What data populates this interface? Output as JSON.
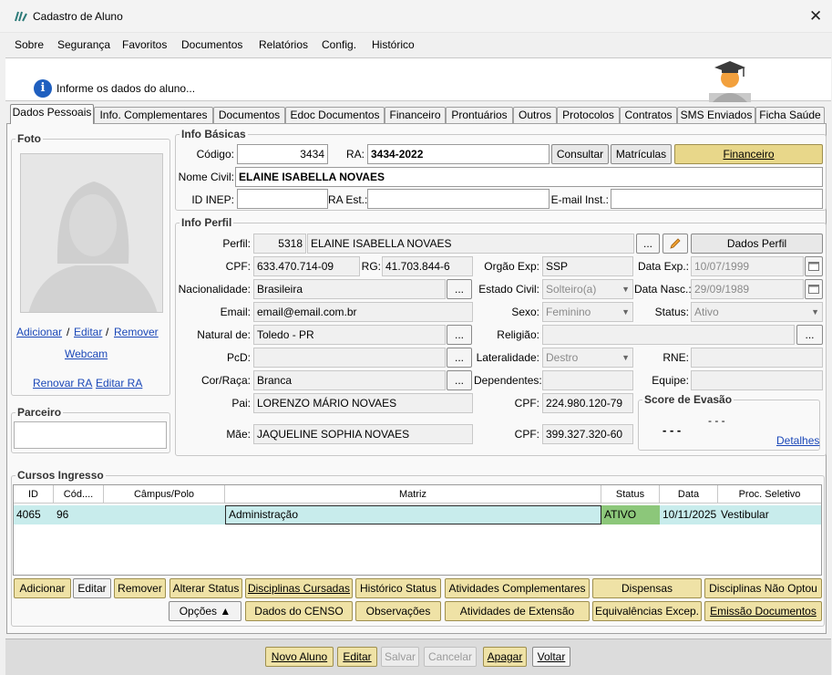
{
  "window": {
    "title": "Cadastro de Aluno",
    "close": "✕"
  },
  "menu": [
    "Sobre",
    "Segurança",
    "Favoritos",
    "Documentos",
    "Relatórios",
    "Config.",
    "Histórico"
  ],
  "header": {
    "text": "Informe os dados do aluno...",
    "info_icon": "i"
  },
  "tabs": [
    "Dados Pessoais",
    "Info. Complementares",
    "Documentos",
    "Edoc Documentos",
    "Financeiro",
    "Prontuários",
    "Outros",
    "Protocolos",
    "Contratos",
    "SMS Enviados",
    "Ficha Saúde"
  ],
  "foto": {
    "title": "Foto",
    "adicionar": "Adicionar",
    "sep1": "/",
    "editar": "Editar",
    "sep2": "/",
    "remover": "Remover",
    "webcam": "Webcam",
    "renovar_ra": "Renovar RA",
    "editar_ra": "Editar RA"
  },
  "parceiro": {
    "title": "Parceiro",
    "value": ""
  },
  "basicas": {
    "title": "Info Básicas",
    "codigo_label": "Código:",
    "codigo": "3434",
    "ra_label": "RA:",
    "ra": "3434-2022",
    "consultar": "Consultar",
    "matriculas": "Matrículas",
    "financeiro": "Financeiro",
    "nome_label": "Nome Civil:",
    "nome": "ELAINE ISABELLA NOVAES",
    "inep_label": "ID INEP:",
    "inep": "",
    "raest_label": "RA Est.:",
    "raest": "",
    "email_inst_label": "E-mail Inst.:",
    "email_inst": ""
  },
  "perfil": {
    "title": "Info Perfil",
    "perfil_label": "Perfil:",
    "perfil_id": "5318",
    "perfil_nome": "ELAINE ISABELLA NOVAES",
    "dots": "...",
    "dados_perfil": "Dados Perfil",
    "cpf_label": "CPF:",
    "cpf": "633.470.714-09",
    "rg_label": "RG:",
    "rg": "41.703.844-6",
    "orgao_label": "Orgão Exp:",
    "orgao": "SSP",
    "dataexp_label": "Data Exp.:",
    "dataexp": "10/07/1999",
    "nac_label": "Nacionalidade:",
    "nac": "Brasileira",
    "estcivil_label": "Estado Civil:",
    "estcivil": "Solteiro(a)",
    "datanasc_label": "Data Nasc.:",
    "datanasc": "29/09/1989",
    "email_label": "Email:",
    "email": "email@email.com.br",
    "sexo_label": "Sexo:",
    "sexo": "Feminino",
    "status_label": "Status:",
    "status": "Ativo",
    "natural_label": "Natural de:",
    "natural": "Toledo - PR",
    "religiao_label": "Religião:",
    "religiao": "",
    "pcd_label": "PcD:",
    "pcd": "",
    "lateral_label": "Lateralidade:",
    "lateral": "Destro",
    "rne_label": "RNE:",
    "rne": "",
    "cor_label": "Cor/Raça:",
    "cor": "Branca",
    "dependentes_label": "Dependentes:",
    "dependentes": "",
    "equipe_label": "Equipe:",
    "equipe": "",
    "pai_label": "Pai:",
    "pai": "LORENZO MÁRIO NOVAES",
    "cpfpai_label": "CPF:",
    "cpfpai": "224.980.120-79",
    "mae_label": "Mãe:",
    "mae": "JAQUELINE SOPHIA NOVAES",
    "cpfmae_label": "CPF:",
    "cpfmae": "399.327.320-60",
    "score_title": "Score de Evasão",
    "score_a": "- - -",
    "score_b": "- - -",
    "detalhes": "Detalhes"
  },
  "cursos": {
    "title": "Cursos Ingresso",
    "headers": [
      "ID",
      "Cód....",
      "Câmpus/Polo",
      "Matriz",
      "Status",
      "Data",
      "Proc. Seletivo"
    ],
    "row": {
      "id": "4065",
      "cod": "96",
      "campus": "",
      "matriz": "Administração",
      "status": "ATIVO",
      "data": "10/11/2025",
      "proc": "Vestibular"
    },
    "status_color": "#8cc77a"
  },
  "actions_row1": [
    "Adicionar",
    "Editar",
    "Remover",
    "Alterar Status",
    "Disciplinas Cursadas",
    "Histórico Status",
    "Atividades Complementares",
    "Dispensas",
    "Disciplinas Não Optou"
  ],
  "actions_row2": [
    "Opções ▲",
    "Dados do CENSO",
    "Observações",
    "Atividades de Extensão",
    "Equivalências Excep.",
    "Emissão Documentos"
  ],
  "footer": [
    "Novo Aluno",
    "Editar",
    "Salvar",
    "Cancelar",
    "Apagar",
    "Voltar"
  ]
}
